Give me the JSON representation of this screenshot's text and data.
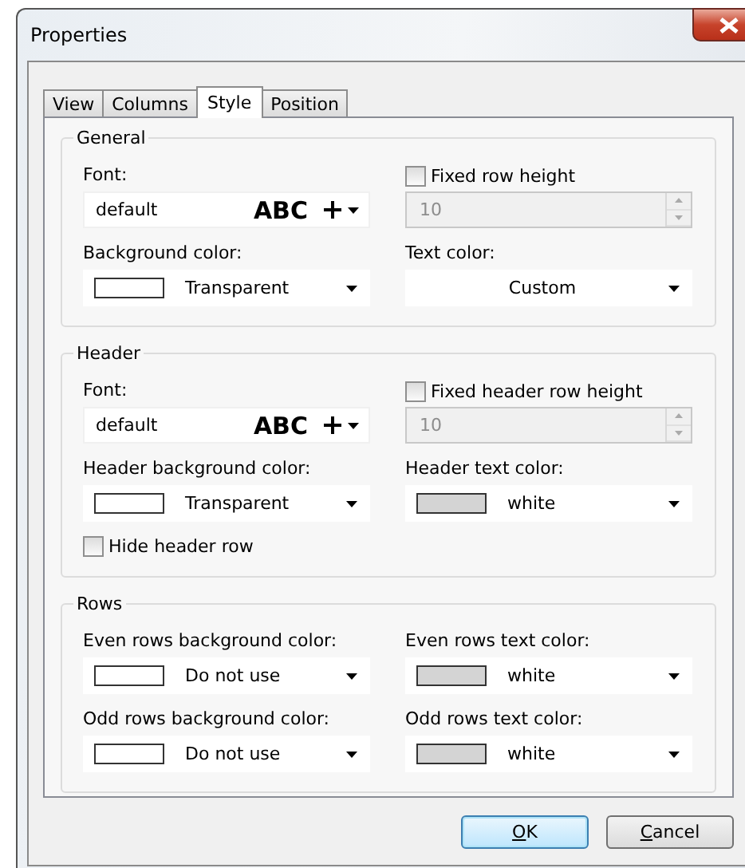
{
  "window": {
    "title": "Properties"
  },
  "tabs": [
    {
      "label": "View",
      "selected": false
    },
    {
      "label": "Columns",
      "selected": false
    },
    {
      "label": "Style",
      "selected": true
    },
    {
      "label": "Position",
      "selected": false
    }
  ],
  "groups": [
    {
      "title": "General",
      "fields": [
        {
          "kind": "font",
          "label": "Font:",
          "value": "default",
          "preview": "ABC"
        },
        {
          "kind": "spin",
          "label": "Fixed row height",
          "checked": false,
          "value": "10",
          "disabled": true
        },
        {
          "kind": "color",
          "label": "Background color:",
          "value": "Transparent",
          "color": "#ffffff"
        },
        {
          "kind": "color",
          "label": "Text color:",
          "value": "Custom"
        }
      ]
    },
    {
      "title": "Header",
      "fields": [
        {
          "kind": "font",
          "label": "Font:",
          "value": "default",
          "preview": "ABC"
        },
        {
          "kind": "spin",
          "label": "Fixed header row height",
          "checked": false,
          "value": "10",
          "disabled": true
        },
        {
          "kind": "color",
          "label": "Header background color:",
          "value": "Transparent",
          "color": "#ffffff"
        },
        {
          "kind": "color",
          "label": "Header text color:",
          "value": "white",
          "color": "#d4d4d4"
        },
        {
          "kind": "check",
          "label": "Hide header row",
          "checked": false
        }
      ]
    },
    {
      "title": "Rows",
      "fields": [
        {
          "kind": "color",
          "label": "Even rows background color:",
          "value": "Do not use",
          "color": "#ffffff"
        },
        {
          "kind": "color",
          "label": "Even rows text color:",
          "value": "white",
          "color": "#d4d4d4"
        },
        {
          "kind": "color",
          "label": "Odd rows background color:",
          "value": "Do not use",
          "color": "#ffffff"
        },
        {
          "kind": "color",
          "label": "Odd rows text color:",
          "value": "white",
          "color": "#d4d4d4"
        }
      ]
    }
  ],
  "buttons": [
    {
      "label": "OK",
      "default": true,
      "mnemonic": true
    },
    {
      "label": "Cancel",
      "default": false,
      "mnemonic": true
    }
  ]
}
